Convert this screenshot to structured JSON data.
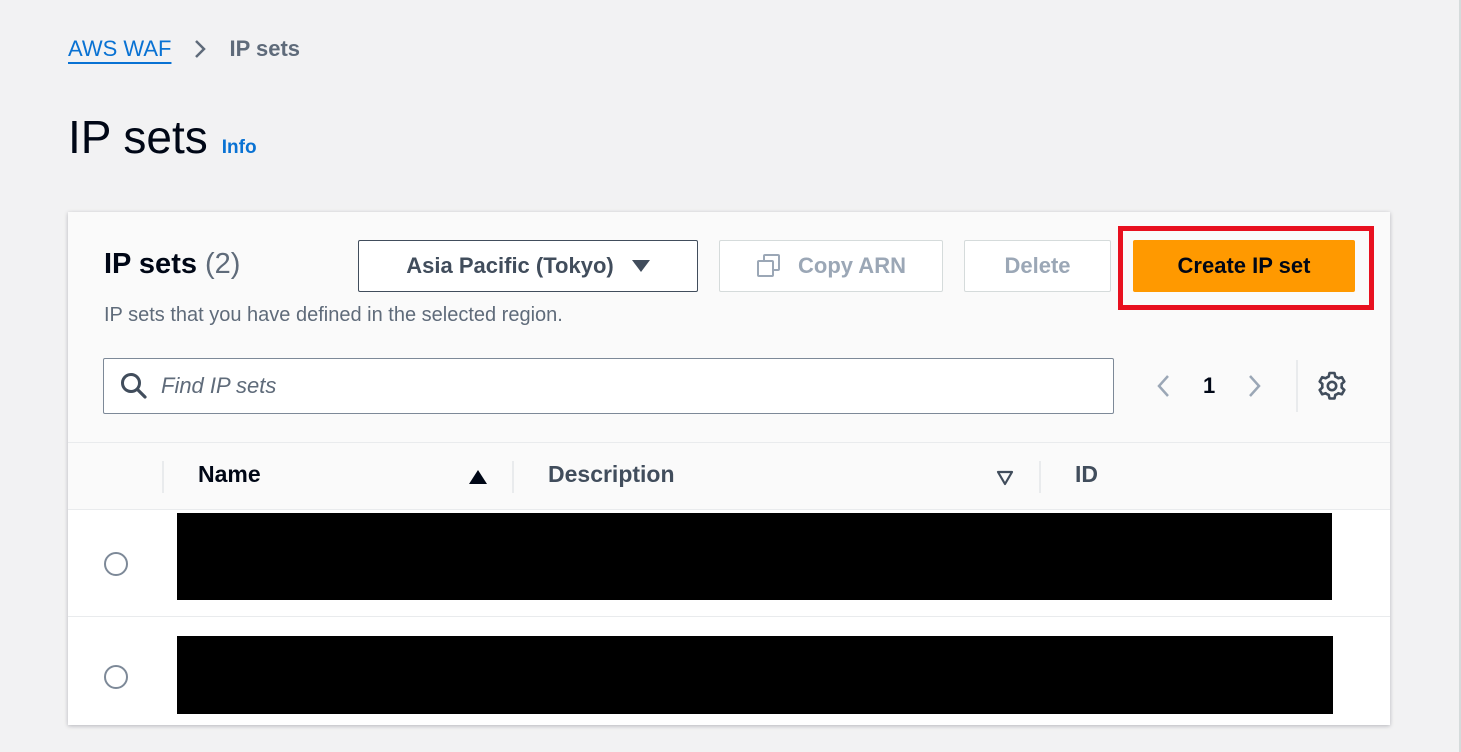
{
  "breadcrumb": {
    "parent": "AWS WAF",
    "current": "IP sets"
  },
  "page": {
    "title": "IP sets",
    "info_link": "Info"
  },
  "container": {
    "title": "IP sets",
    "count": "(2)",
    "description": "IP sets that you have defined in the selected region.",
    "region_select": "Asia Pacific (Tokyo)",
    "copy_arn_label": "Copy ARN",
    "delete_label": "Delete",
    "create_label": "Create IP set"
  },
  "search": {
    "placeholder": "Find IP sets",
    "value": ""
  },
  "pagination": {
    "current_page": "1"
  },
  "table": {
    "columns": [
      "Name",
      "Description",
      "ID"
    ],
    "rows": [
      {
        "redacted": true
      },
      {
        "redacted": true
      }
    ]
  },
  "colors": {
    "primary_button": "#ff9900",
    "link": "#0972d3",
    "highlight": "#e8101f"
  },
  "icons": [
    "chevron-right-icon",
    "caret-down-icon",
    "copy-icon",
    "search-icon",
    "chevron-left-icon",
    "chevron-right-icon",
    "gear-icon",
    "sort-ascending-icon",
    "sort-descending-icon"
  ]
}
